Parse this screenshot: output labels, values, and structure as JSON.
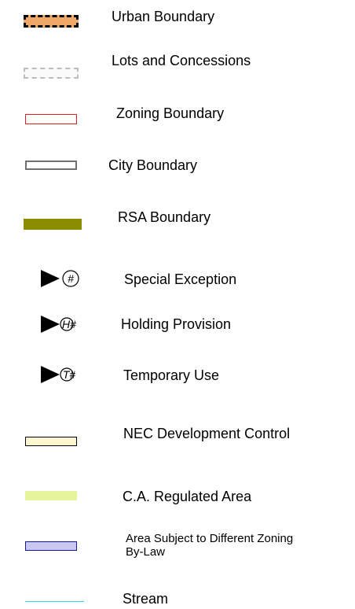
{
  "legend": {
    "items": [
      {
        "label": "Urban Boundary",
        "symbol": "dashed-orange-box",
        "colors": {
          "fill": "#f0a868",
          "stroke": "#000000"
        }
      },
      {
        "label": "Lots and Concessions",
        "symbol": "dashed-gray-box",
        "colors": {
          "stroke": "#bdbdbd"
        }
      },
      {
        "label": "Zoning Boundary",
        "symbol": "red-outline-box",
        "colors": {
          "stroke": "#e02020"
        }
      },
      {
        "label": "City Boundary",
        "symbol": "gray-outline-box",
        "colors": {
          "stroke": "#707070"
        }
      },
      {
        "label": "RSA Boundary",
        "symbol": "dashed-olive-box",
        "colors": {
          "stroke": "#8c8c00"
        }
      },
      {
        "label": "Special Exception",
        "symbol": "triangle-hash-circle",
        "glyph": "#"
      },
      {
        "label": "Holding Provision",
        "symbol": "triangle-h-hash",
        "glyph": "H#"
      },
      {
        "label": "Temporary Use",
        "symbol": "triangle-t-hash",
        "glyph": "T#"
      },
      {
        "label": "NEC Development Control",
        "symbol": "cream-box",
        "colors": {
          "fill": "#fdf7cf",
          "stroke": "#000000"
        }
      },
      {
        "label": "C.A. Regulated Area",
        "symbol": "lime-box",
        "colors": {
          "fill": "#e6f59a"
        }
      },
      {
        "label": "Area Subject to Different Zoning  By-Law",
        "symbol": "blue-box",
        "colors": {
          "fill": "#c8c8f0",
          "stroke": "#1a1a8c"
        }
      },
      {
        "label": "Stream",
        "symbol": "cyan-line",
        "colors": {
          "stroke": "#3ad6e6"
        }
      }
    ]
  }
}
